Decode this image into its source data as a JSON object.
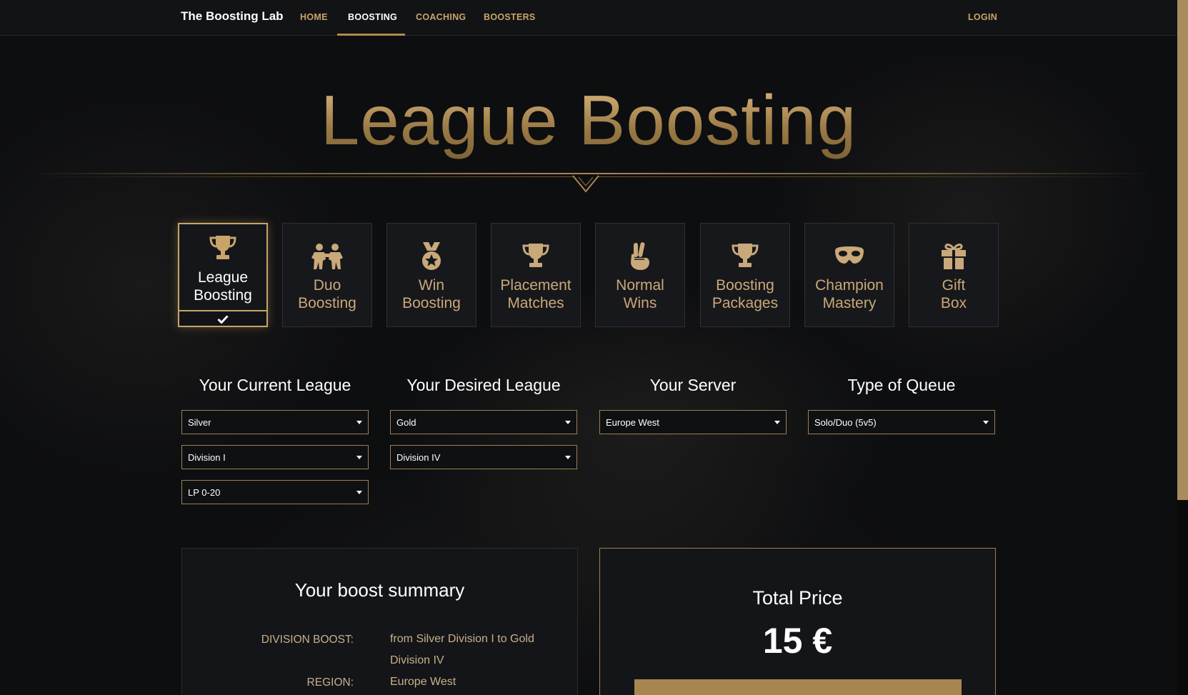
{
  "nav": {
    "brand": "The Boosting Lab",
    "links": [
      {
        "label": "HOME"
      },
      {
        "label": "BOOSTING",
        "active": true
      },
      {
        "label": "COACHING"
      },
      {
        "label": "BOOSTERS"
      }
    ],
    "login": "LOGIN"
  },
  "hero": {
    "title": "League Boosting"
  },
  "services": [
    {
      "line1": "League",
      "line2": "Boosting",
      "icon": "trophy-icon",
      "selected": true
    },
    {
      "line1": "Duo",
      "line2": "Boosting",
      "icon": "duo-players-icon"
    },
    {
      "line1": "Win",
      "line2": "Boosting",
      "icon": "medal-icon"
    },
    {
      "line1": "Placement",
      "line2": "Matches",
      "icon": "trophy-icon"
    },
    {
      "line1": "Normal",
      "line2": "Wins",
      "icon": "peace-hand-icon"
    },
    {
      "line1": "Boosting",
      "line2": "Packages",
      "icon": "trophy-icon"
    },
    {
      "line1": "Champion",
      "line2": "Mastery",
      "icon": "mask-icon"
    },
    {
      "line1": "Gift",
      "line2": "Box",
      "icon": "gift-icon"
    }
  ],
  "form": {
    "current_league": {
      "title": "Your Current League",
      "league": "Silver",
      "division": "Division I",
      "lp": "LP 0-20"
    },
    "desired_league": {
      "title": "Your Desired League",
      "league": "Gold",
      "division": "Division IV"
    },
    "server": {
      "title": "Your Server",
      "value": "Europe West"
    },
    "queue": {
      "title": "Type of Queue",
      "value": "Solo/Duo (5v5)"
    }
  },
  "summary": {
    "title": "Your boost summary",
    "division_boost_label": "DIVISION BOOST:",
    "division_boost_value": "from Silver Division I to Gold Division IV",
    "region_label": "REGION:",
    "region_value": "Europe West"
  },
  "price": {
    "label": "Total Price",
    "value": "15 €"
  },
  "colors": {
    "accent": "#c9a46a",
    "background": "#0d0e10",
    "card": "#17181b"
  }
}
